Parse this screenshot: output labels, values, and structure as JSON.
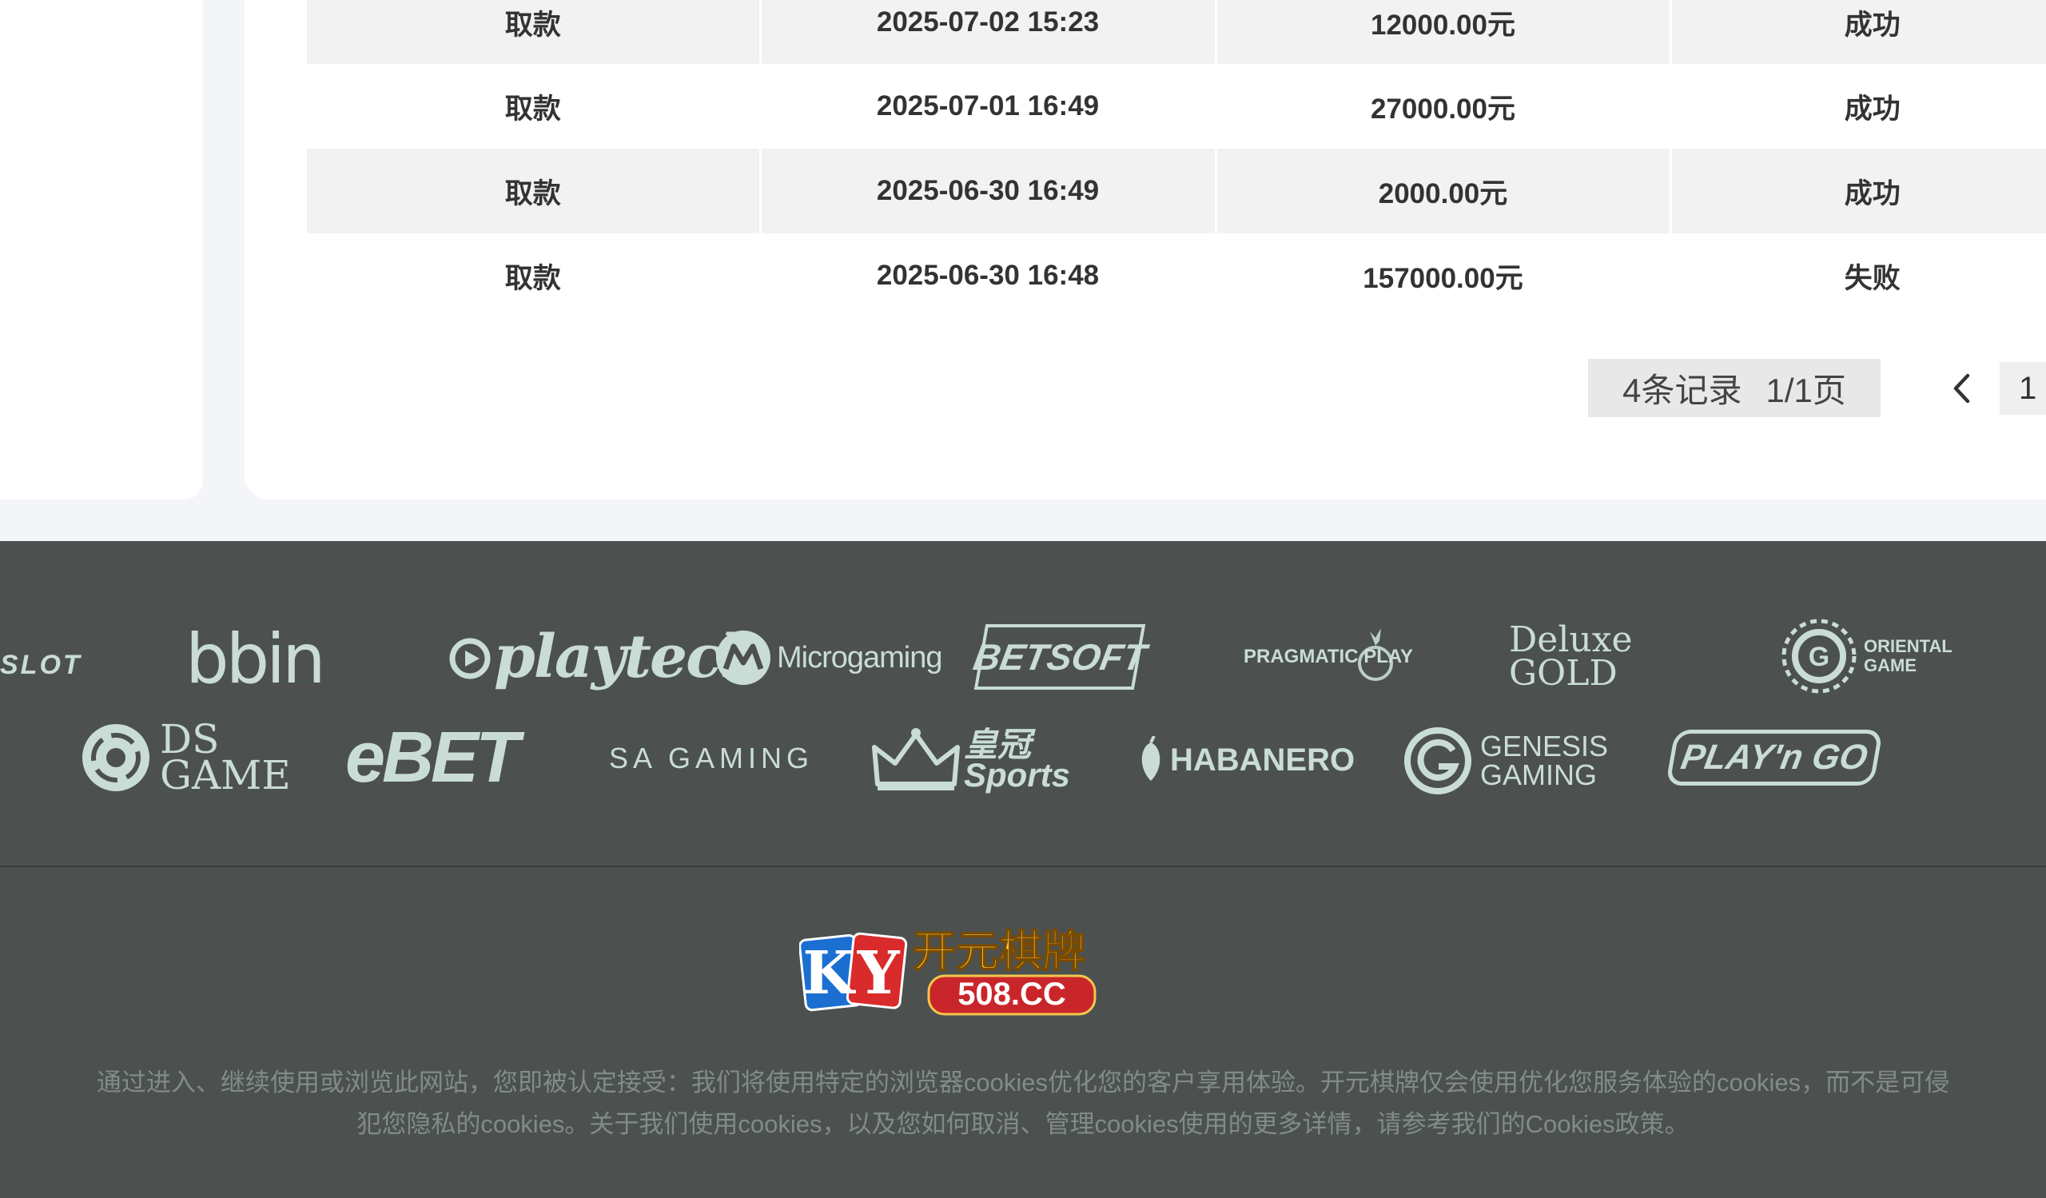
{
  "records": [
    {
      "type": "取款",
      "time": "2025-07-02 15:23",
      "amount": "12000.00元",
      "status": "成功"
    },
    {
      "type": "取款",
      "time": "2025-07-01 16:49",
      "amount": "27000.00元",
      "status": "成功"
    },
    {
      "type": "取款",
      "time": "2025-06-30 16:49",
      "amount": "2000.00元",
      "status": "成功"
    },
    {
      "type": "取款",
      "time": "2025-06-30 16:48",
      "amount": "157000.00元",
      "status": "失败"
    }
  ],
  "pagination": {
    "total_records": "4条记录",
    "page_of": "1/1页",
    "current_page": "1",
    "prev_icon": "chevron-left-icon"
  },
  "partner_logos": {
    "row1": [
      "SLOT",
      "bbin",
      "playtech",
      "Microgaming",
      "BETSOFT",
      "PRAGMATIC PLAY",
      "Deluxe GOLD",
      "ORIENTAL GAME"
    ],
    "row2": [
      "DS GAME",
      "eBET",
      "SA GAMING",
      "皇冠 Sports",
      "HABANERO",
      "GENESIS GAMING",
      "PLAY'n GO"
    ]
  },
  "brand": {
    "name": "开元棋牌",
    "letters": "KY",
    "domain": "508.CC"
  },
  "footer_notice": "通过进入、继续使用或浏览此网站，您即被认定接受：我们将使用特定的浏览器cookies优化您的客户享用体验。开元棋牌仅会使用优化您服务体验的cookies，而不是可侵犯您隐私的cookies。关于我们使用cookies，以及您如何取消、管理cookies使用的更多详情，请参考我们的Cookies政策。",
  "colors": {
    "footer_bg": "#4c5150",
    "logo_tint": "#c9dcd6",
    "row_shade": "#f2f2f2"
  }
}
